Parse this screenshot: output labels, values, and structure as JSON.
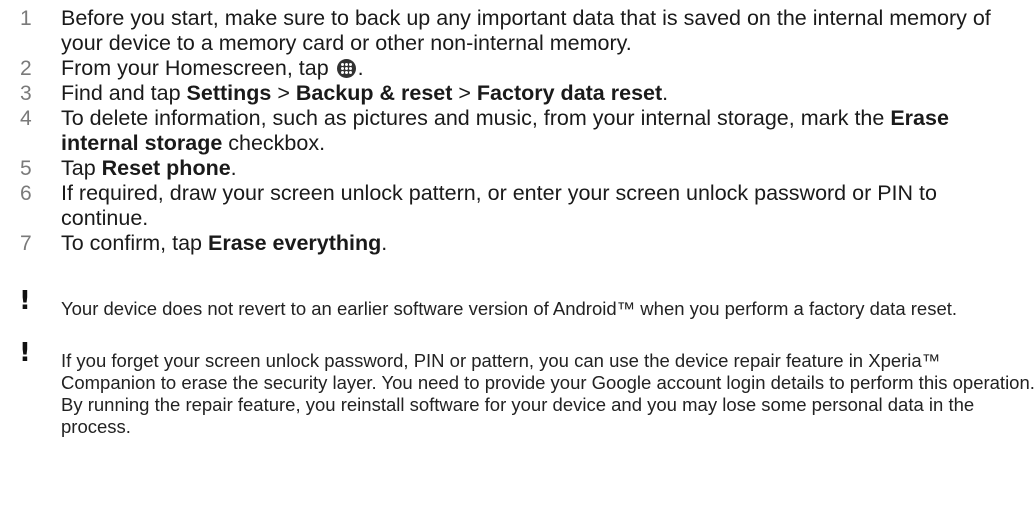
{
  "steps": [
    {
      "num": "1",
      "text": "Before you start, make sure to back up any important data that is saved on the internal memory of your device to a memory card or other non-internal memory."
    },
    {
      "num": "2",
      "before": "From your Homescreen, tap ",
      "icon": "apps-grid-icon",
      "after": "."
    },
    {
      "num": "3",
      "prefix": "Find and tap ",
      "b1": "Settings",
      "sep1": " > ",
      "b2": "Backup & reset",
      "sep2": " > ",
      "b3": "Factory data reset",
      "suffix": "."
    },
    {
      "num": "4",
      "prefix": "To delete information, such as pictures and music, from your internal storage, mark the ",
      "bold": "Erase internal storage",
      "suffix": " checkbox."
    },
    {
      "num": "5",
      "prefix": "Tap ",
      "bold": "Reset phone",
      "suffix": "."
    },
    {
      "num": "6",
      "text": "If required, draw your screen unlock pattern, or enter your screen unlock password or PIN to continue."
    },
    {
      "num": "7",
      "prefix": "To confirm, tap ",
      "bold": "Erase everything",
      "suffix": "."
    }
  ],
  "notes": [
    {
      "icon": "exclamation-icon",
      "symbol": "!",
      "text": "Your device does not revert to an earlier software version of Android™ when you perform a factory data reset."
    },
    {
      "icon": "exclamation-icon",
      "symbol": "!",
      "text": "If you forget your screen unlock password, PIN or pattern, you can use the device repair feature in Xperia™ Companion to erase the security layer. You need to provide your Google account login details to perform this operation. By running the repair feature, you reinstall software for your device and you may lose some personal data in the process."
    }
  ]
}
